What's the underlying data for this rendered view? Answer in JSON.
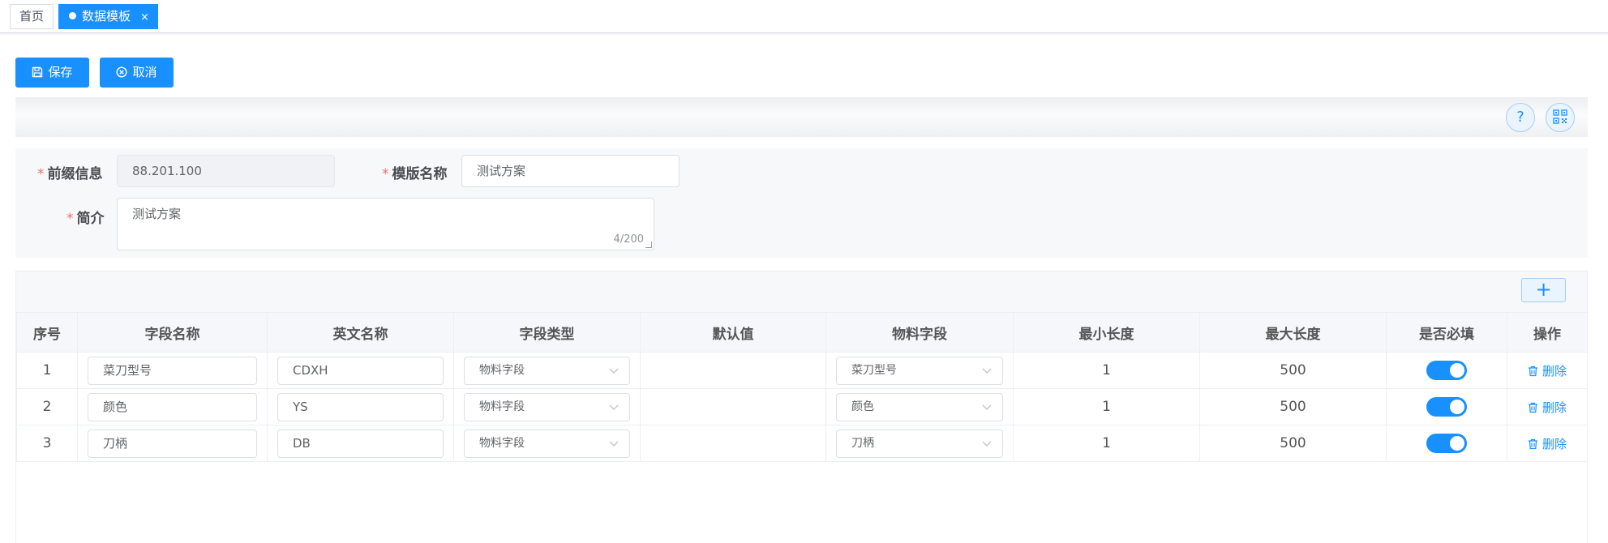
{
  "tabs": [
    {
      "label": "首页"
    },
    {
      "label": "数据模板",
      "close": "×"
    }
  ],
  "toolbar": {
    "save_label": "保存",
    "cancel_label": "取消"
  },
  "info_strip": {
    "help_icon": "question-icon",
    "qr_icon": "qrcode-icon"
  },
  "form": {
    "prefix": {
      "label": "前缀信息",
      "value": "88.201.100"
    },
    "template_name": {
      "label": "模版名称",
      "value": "测试方案"
    },
    "summary": {
      "label": "简介",
      "value": "测试方案",
      "counter": "4/200"
    }
  },
  "table": {
    "add_label": "+",
    "columns": [
      "序号",
      "字段名称",
      "英文名称",
      "字段类型",
      "默认值",
      "物料字段",
      "最小长度",
      "最大长度",
      "是否必填",
      "操作"
    ],
    "rows": [
      {
        "index": "1",
        "field_name": "菜刀型号",
        "english_name": "CDXH",
        "field_type": "物料字段",
        "default_value": "",
        "material_field": "菜刀型号",
        "min_length": "1",
        "max_length": "500",
        "required": true,
        "action": "删除"
      },
      {
        "index": "2",
        "field_name": "颜色",
        "english_name": "YS",
        "field_type": "物料字段",
        "default_value": "",
        "material_field": "颜色",
        "min_length": "1",
        "max_length": "500",
        "required": true,
        "action": "删除"
      },
      {
        "index": "3",
        "field_name": "刀柄",
        "english_name": "DB",
        "field_type": "物料字段",
        "default_value": "",
        "material_field": "刀柄",
        "min_length": "1",
        "max_length": "500",
        "required": true,
        "action": "删除"
      }
    ]
  },
  "colors": {
    "primary": "#1890ff",
    "required_star": "#f56c6c"
  }
}
